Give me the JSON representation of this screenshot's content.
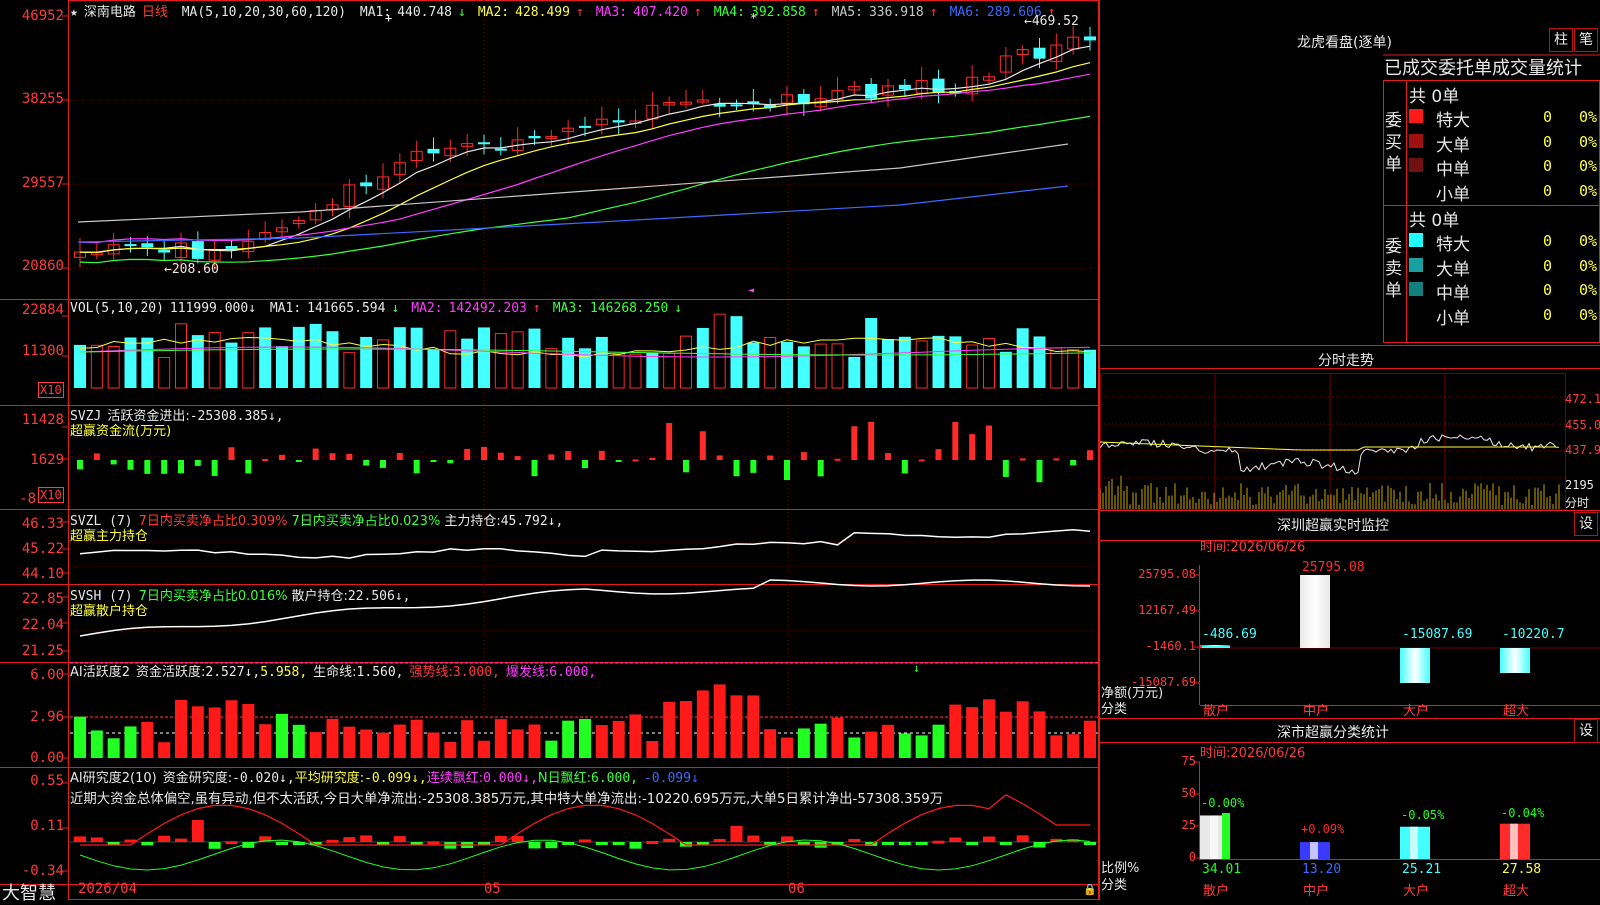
{
  "stock": {
    "name": "深南电路",
    "period": "日线",
    "star": "★"
  },
  "ma_header": {
    "label": "MA(5,10,20,30,60,120)",
    "items": [
      {
        "name": "MA1",
        "value": "440.748",
        "arrow": "↓",
        "color": "#e8e8e8"
      },
      {
        "name": "MA2",
        "value": "428.499",
        "arrow": "↑",
        "color": "#ffff3a"
      },
      {
        "name": "MA3",
        "value": "407.420",
        "arrow": "↑",
        "color": "#ff3cff"
      },
      {
        "name": "MA4",
        "value": "392.858",
        "arrow": "↑",
        "color": "#3cff3c"
      },
      {
        "name": "MA5",
        "value": "336.918",
        "arrow": "↑",
        "color": "#c8c8c8"
      },
      {
        "name": "MA6",
        "value": "289.606",
        "arrow": "↑",
        "color": "#3a6bff"
      }
    ]
  },
  "main_chart": {
    "yticks": [
      "46952",
      "38255",
      "29557",
      "20860"
    ],
    "high_label": "469.52",
    "low_label": "208.60",
    "high_arrow": "←",
    "low_arrow": "←"
  },
  "vol": {
    "label": "VOL(5,10,20)",
    "value": "111999.000",
    "arrow": "↓",
    "ma": [
      {
        "name": "MA1",
        "value": "141665.594",
        "arrow": "↓",
        "color": "#e8e8e8"
      },
      {
        "name": "MA2",
        "value": "142492.203",
        "arrow": "↑",
        "color": "#ff3cff"
      },
      {
        "name": "MA3",
        "value": "146268.250",
        "arrow": "↓",
        "color": "#3cff3c"
      }
    ],
    "yticks": [
      "22884",
      "11300"
    ],
    "unit": "X10"
  },
  "svzj": {
    "label": "SVZJ",
    "text": "活跃资金进出:",
    "value": "-25308.385",
    "arrow": "↓,",
    "sub": "超赢资金流(万元)",
    "yticks": [
      "11428",
      "1629",
      "-8"
    ],
    "unit": "X10"
  },
  "svzl": {
    "label": "SVZL (7)",
    "t1": "7日内买卖净占比0.309%",
    "t2": "7日内买卖净占比0.023%",
    "t3": "主力持仓:",
    "v3": "45.792",
    "arrow": "↓,",
    "sub": "超赢主力持仓",
    "yticks": [
      "46.33",
      "45.22",
      "44.10"
    ]
  },
  "svsh": {
    "label": "SVSH (7)",
    "t1": "7日内买卖净占比0.016%",
    "t2": "散户持仓:",
    "v2": "22.506",
    "arrow": "↓,",
    "sub": "超赢散户持仓",
    "yticks": [
      "22.85",
      "22.04",
      "21.25"
    ]
  },
  "ai2": {
    "label": "AI活跃度2",
    "t1": "资金活跃度:",
    "v1": "2.527",
    "a1": "↓,",
    "v2": "5.958,",
    "t3": "生命线:",
    "v3": "1.560,",
    "t4": "强势线:",
    "v4": "3.000,",
    "t5": "爆发线:",
    "v5": "6.000,",
    "yticks": [
      "6.00",
      "2.96",
      "0.00"
    ]
  },
  "ai3": {
    "label": "AI研究度2(10)",
    "t1": "资金研究度:",
    "v1": "-0.020",
    "a1": "↓,",
    "t2": "平均研究度:",
    "v2": "-0.099",
    "a2": "↓,",
    "t3": "连续飘红:",
    "v3": "0.000",
    "a3": "↓,",
    "t4": "N日飘红:",
    "v4": "6.000,",
    "v5": "-0.099",
    "a5": "↓",
    "comment": "近期大资金总体偏空,虽有异动,但不太活跃,今日大单净流出:-25308.385万元,其中特大单净流出:-10220.695万元,大单5日累计净出-57308.359万",
    "yticks": [
      "0.55",
      "0.11",
      "-0.34"
    ]
  },
  "footer": {
    "brand": "大智慧",
    "date": "2026/04",
    "month1": "05",
    "month2": "06"
  },
  "right": {
    "lhb": {
      "title": "龙虎看盘(逐单)",
      "btn1": "柱",
      "btn2": "笔",
      "subtitle": "已成交委托单成交量统计",
      "buy": {
        "label": "委买单",
        "total": "共 0单",
        "rows": [
          {
            "label": "特大",
            "v": "0",
            "p": "0%",
            "color": "#ff1a1a"
          },
          {
            "label": "大单",
            "v": "0",
            "p": "0%",
            "color": "#a01010"
          },
          {
            "label": "中单",
            "v": "0",
            "p": "0%",
            "color": "#701010"
          },
          {
            "label": "小单",
            "v": "0",
            "p": "0%",
            "color": ""
          }
        ]
      },
      "sell": {
        "label": "委卖单",
        "total": "共 0单",
        "rows": [
          {
            "label": "特大",
            "v": "0",
            "p": "0%",
            "color": "#22ffff"
          },
          {
            "label": "大单",
            "v": "0",
            "p": "0%",
            "color": "#1aa0a0"
          },
          {
            "label": "中单",
            "v": "0",
            "p": "0%",
            "color": "#138080"
          },
          {
            "label": "小单",
            "v": "0",
            "p": "0%",
            "color": ""
          }
        ]
      }
    },
    "fenshi": {
      "title": "分时走势",
      "yticks": [
        "472.1",
        "455.0",
        "437.9"
      ],
      "vol_tick": "2195",
      "unit": "分时"
    },
    "sz_monitor": {
      "title": "深圳超赢实时监控",
      "btn": "设",
      "time_label": "时间:",
      "time": "2026/06/26",
      "yticks": [
        "25795.08",
        "12167.49",
        "-1460.1",
        "-15087.69"
      ],
      "ylabel1": "净额(万元)",
      "ylabel2": "分类",
      "categories": [
        "散户",
        "中户",
        "大户",
        "超大"
      ],
      "values": [
        "-486.69",
        "25795.08",
        "-15087.69",
        "-10220.7"
      ]
    },
    "sz_class": {
      "title": "深市超赢分类统计",
      "btn": "设",
      "time_label": "时间:",
      "time": "2026/06/26",
      "yticks": [
        "75",
        "50",
        "25",
        "0"
      ],
      "ylabel1": "比例%",
      "ylabel2": "分类",
      "categories": [
        "散户",
        "中户",
        "大户",
        "超大"
      ],
      "pct": [
        "-0.00%",
        "+0.09%",
        "-0.05%",
        "-0.04%"
      ],
      "values": [
        "34.01",
        "13.20",
        "25.21",
        "27.58"
      ]
    }
  }
}
